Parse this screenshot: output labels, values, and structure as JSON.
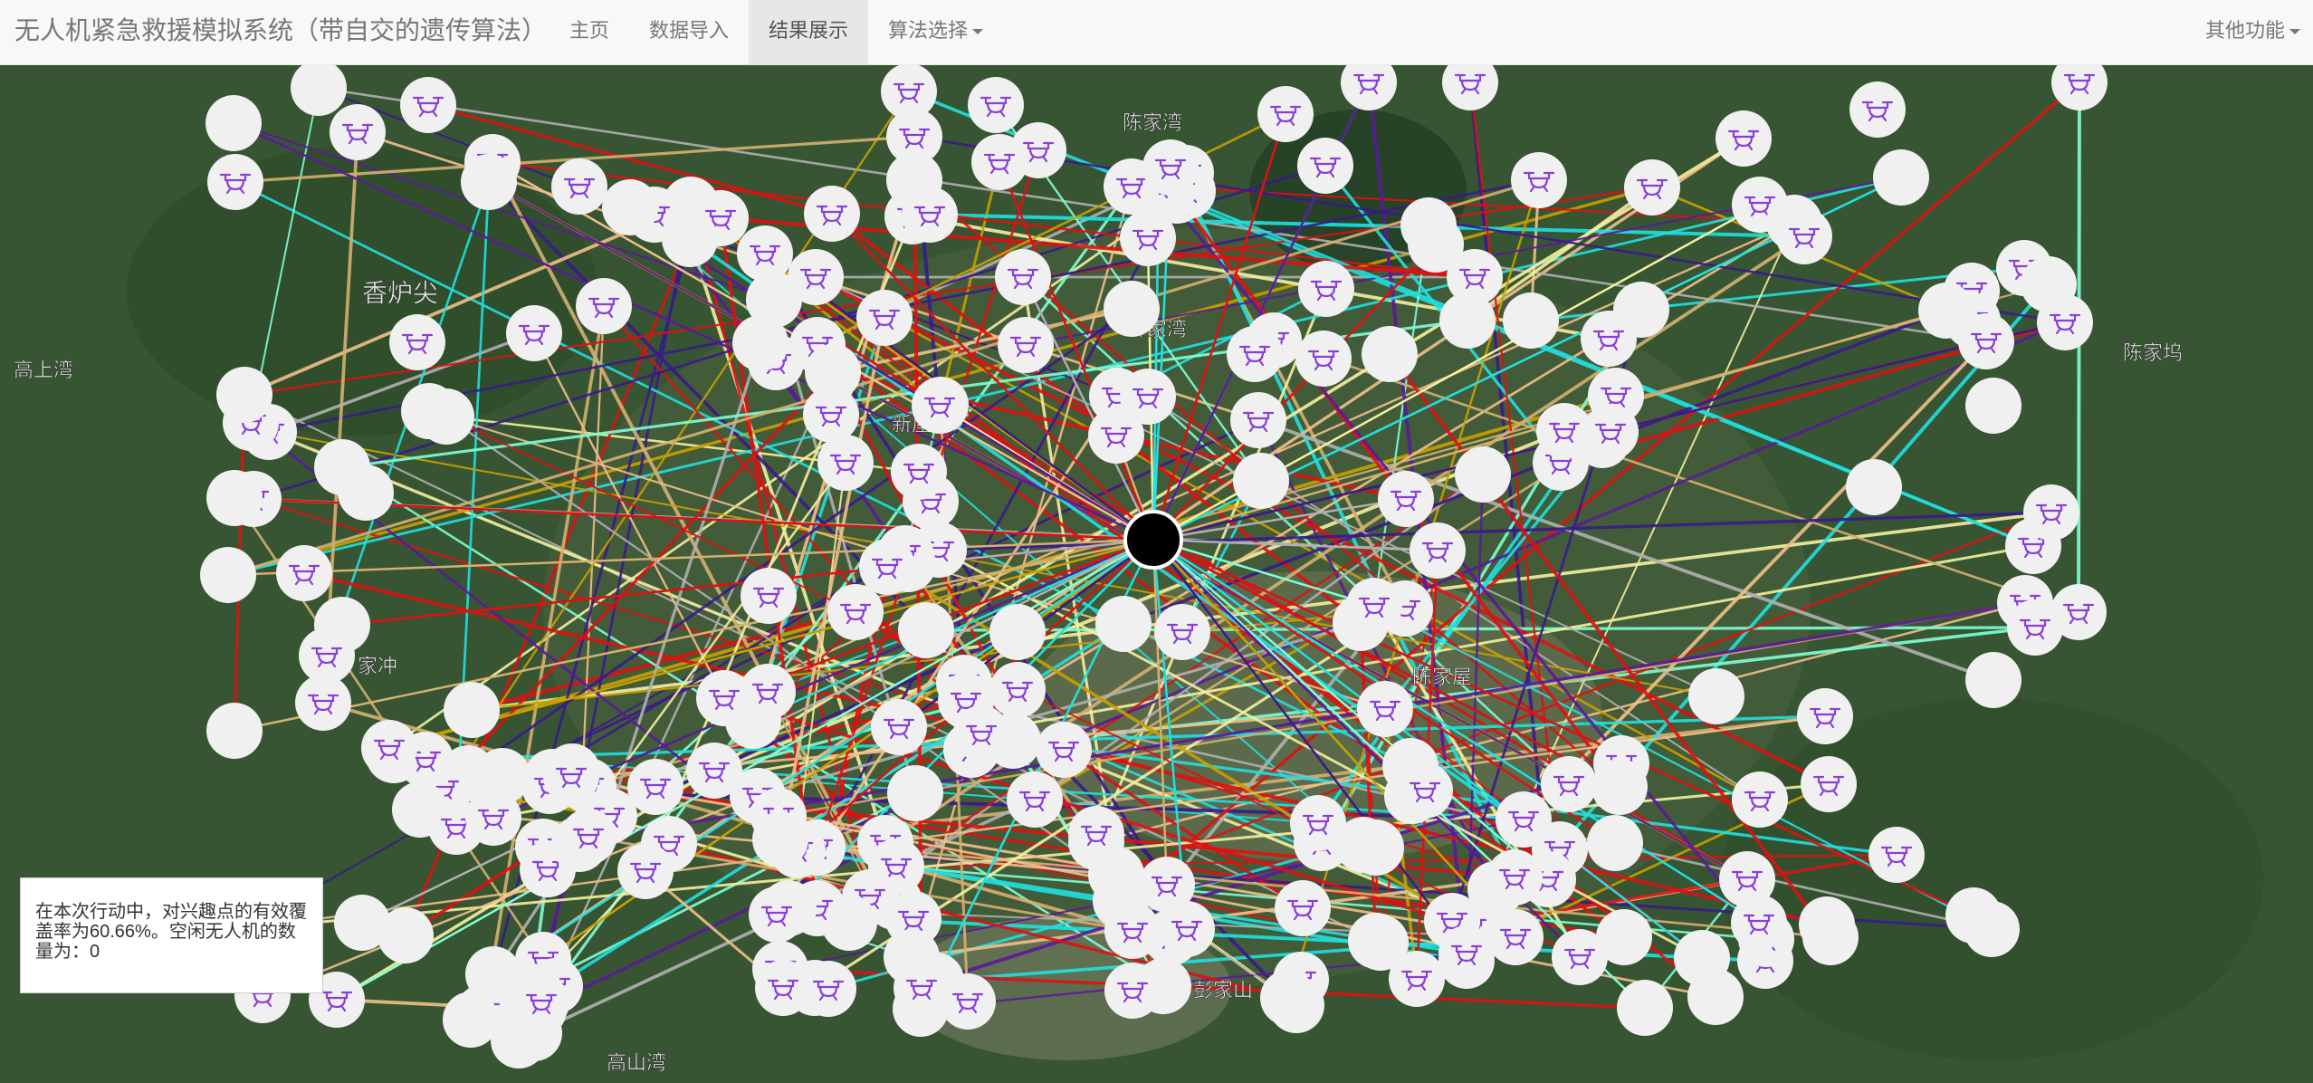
{
  "navbar": {
    "brand": "无人机紧急救援模拟系统（带自交的遗传算法）",
    "items": [
      {
        "label": "主页",
        "active": false
      },
      {
        "label": "数据导入",
        "active": false
      },
      {
        "label": "结果展示",
        "active": true
      },
      {
        "label": "算法选择",
        "active": false,
        "dropdown": true
      }
    ],
    "right": "其他功能"
  },
  "map": {
    "place_labels": [
      "香炉尖",
      "陈家湾",
      "钟家湾",
      "新屋",
      "陈家屋",
      "陈家坞",
      "高山湾",
      "彭家山",
      "高上湾",
      "家冲",
      "上"
    ],
    "icon_colors": {
      "node": "#f0f0f0",
      "drone": "#8a3fd6",
      "base": "#000000"
    }
  },
  "info": {
    "text": "在本次行动中，对兴趣点的有效覆盖率为60.66%。空闲无人机的数量为：0"
  }
}
